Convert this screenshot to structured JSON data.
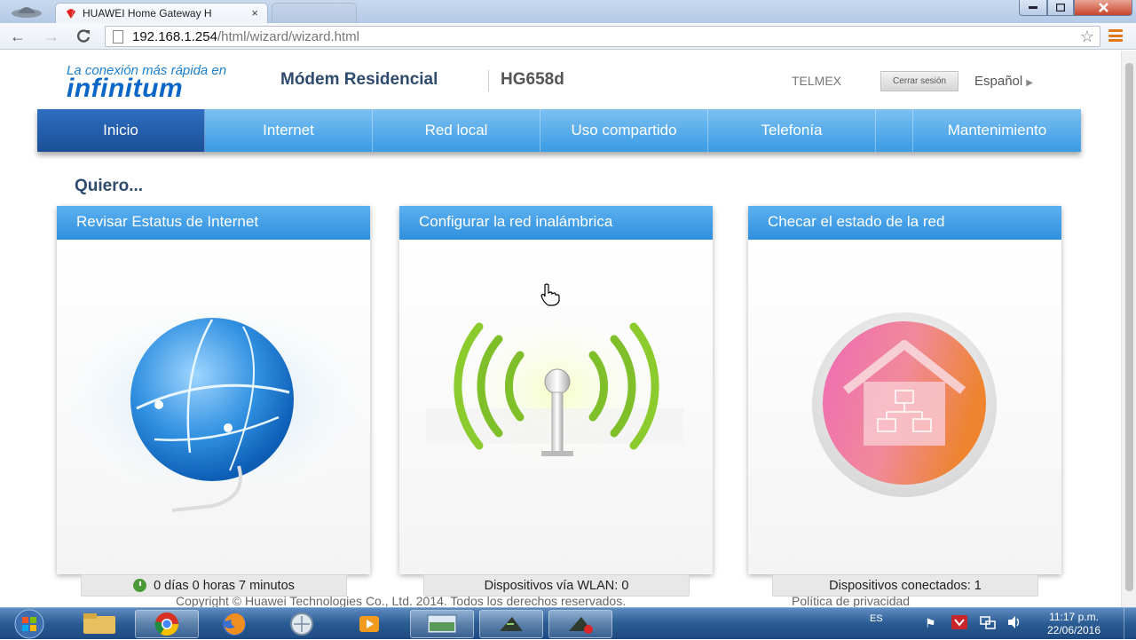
{
  "browser": {
    "tab_title": "HUAWEI Home Gateway H",
    "tab_close": "×",
    "url_host": "192.168.1.254",
    "url_path": "/html/wizard/wizard.html"
  },
  "header": {
    "logo_tagline": "La conexión más rápida en",
    "logo_brand": "infinitum",
    "product_name": "Módem Residencial",
    "model": "HG658d",
    "carrier": "TELMEX",
    "logout_label": "Cerrar sesión",
    "language": "Español"
  },
  "nav": {
    "items": [
      {
        "label": "Inicio"
      },
      {
        "label": "Internet"
      },
      {
        "label": "Red local"
      },
      {
        "label": "Uso compartido"
      },
      {
        "label": "Telefonía"
      },
      {
        "label": "Mantenimiento"
      }
    ]
  },
  "main": {
    "heading": "Quiero...",
    "cards": [
      {
        "title": "Revisar Estatus de Internet",
        "status": "0 días 0 horas 7 minutos",
        "icon": "globe-icon"
      },
      {
        "title": "Configurar la red inalámbrica",
        "status": "Dispositivos vía WLAN: 0",
        "icon": "wireless-antenna-icon"
      },
      {
        "title": "Checar el estado de la red",
        "status": "Dispositivos conectados: 1",
        "icon": "home-network-icon"
      }
    ]
  },
  "footer": {
    "copyright": "Copyright © Huawei Technologies Co., Ltd. 2014. Todos los derechos reservados.",
    "privacy": "Política de privacidad"
  },
  "taskbar": {
    "language": "ES",
    "time": "11:17 p.m.",
    "date": "22/06/2016"
  },
  "colors": {
    "nav_active": "#1b4f97",
    "nav_bg": "#3a9be4",
    "brand_blue": "#0b66c7",
    "menu_accent": "#e07818"
  }
}
